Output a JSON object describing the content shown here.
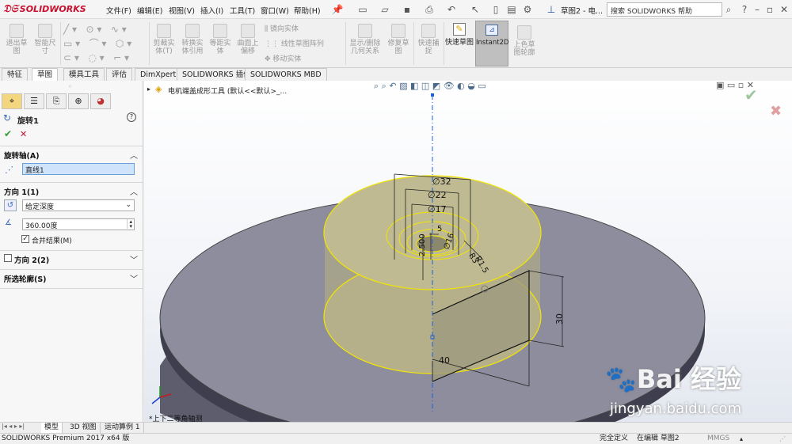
{
  "app": {
    "logo_text": "SOLIDWORKS",
    "doc_title": "草图2 - 电...",
    "search_placeholder": "搜索 SOLIDWORKS 帮助"
  },
  "menu": [
    "文件(F)",
    "编辑(E)",
    "视图(V)",
    "插入(I)",
    "工具(T)",
    "窗口(W)",
    "帮助(H)"
  ],
  "ribbon": {
    "exit_sketch": "退出草图",
    "smart_dim": "智能尺寸",
    "trim": "剪裁实体(T)",
    "convert": "转换实体引用",
    "offset": "等距实体",
    "surface_offset": "曲面上偏移",
    "mirror": "镜向实体",
    "linear_pattern": "线性草图阵列",
    "move": "移动实体",
    "display_relations": "显示/删除几何关系",
    "repair": "修复草图",
    "quick_snap": "快速捕捉",
    "quick_sketch": "快速草图",
    "instant2d": "Instant2D",
    "shaded_contours": "上色草图轮廓"
  },
  "tabs": [
    "特征",
    "草图",
    "模具工具",
    "评估",
    "DimXpert",
    "SOLIDWORKS 插件",
    "SOLIDWORKS MBD"
  ],
  "active_tab": "草图",
  "feature_tree": {
    "root_label": "电机端盖成形工具 (默认<<默认>_..."
  },
  "property_manager": {
    "title": "旋转1",
    "axis_section": "旋转轴(A)",
    "axis_value": "直线1",
    "direction1_section": "方向 1(1)",
    "end_condition": "给定深度",
    "angle_value": "360.00度",
    "merge_label": "合并结果(M)",
    "merge_checked": true,
    "direction2_section": "方向 2(2)",
    "selected_contours": "所选轮廓(S)"
  },
  "viewport": {
    "view_label": "*上下二等角轴测",
    "dims": [
      "∅32",
      "∅22",
      "∅17",
      "5",
      "2.500",
      "∅16",
      "R3",
      "R1.5",
      "30",
      "40"
    ],
    "watermark_brand": "Bai 经验",
    "watermark_url": "jingyan.baidu.com"
  },
  "bottom_tabs": [
    "模型",
    "3D 视图",
    "运动算例 1"
  ],
  "status": {
    "product": "SOLIDWORKS Premium 2017 x64 版",
    "defined": "完全定义",
    "editing": "在编辑 草图2",
    "units": "MMGS"
  },
  "colors": {
    "accent_red": "#c8102e",
    "preview_yellow": "#f2e600",
    "disc_top": "#8d8d9e",
    "ok_green": "#2f9a2f"
  }
}
